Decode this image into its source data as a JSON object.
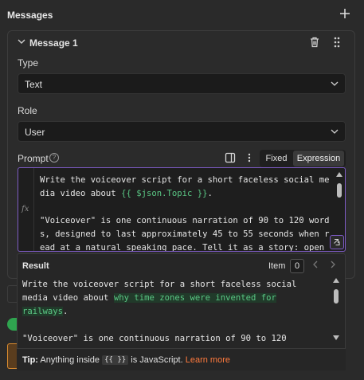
{
  "header": {
    "title": "Messages"
  },
  "message": {
    "label": "Message 1",
    "type": {
      "label": "Type",
      "value": "Text"
    },
    "role": {
      "label": "Role",
      "value": "User"
    },
    "prompt": {
      "label": "Prompt",
      "mode_fixed": "Fixed",
      "mode_expression": "Expression",
      "fx": "fx",
      "lines": [
        "Write the voiceover script for a short faceless social me",
        "dia video about ",
        "{{ $json.Topic }}",
        ".",
        "",
        "\"Voiceover\" is one continuous narration of 90 to 120 word",
        "s, designed to last approximately 45 to 55 seconds when r",
        "ead at a natural speaking pace. Tell it as a story: open"
      ]
    }
  },
  "result": {
    "label": "Result",
    "item_label": "Item",
    "item_value": "0",
    "lines": [
      "Write the voiceover script for a short faceless social",
      "media video about ",
      "why time zones were invented for",
      "railways",
      ".",
      "",
      "\"Voiceover\" is one continuous narration of 90 to 120"
    ]
  },
  "tip": {
    "prefix": "Tip:",
    "text1": "Anything inside",
    "code": "{{ }}",
    "text2": "is JavaScript.",
    "link": "Learn more"
  },
  "colors": {
    "accent": "#7d5bc4",
    "expression": "#5ac784",
    "link": "#ff7a3d"
  }
}
